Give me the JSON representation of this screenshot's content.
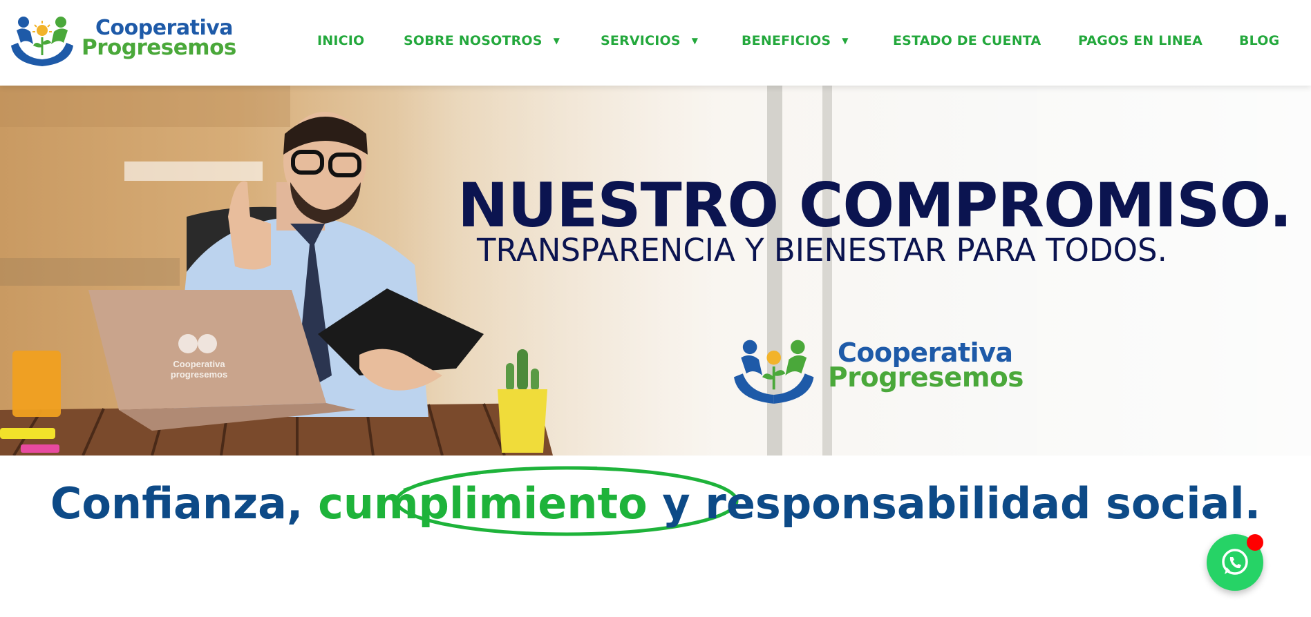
{
  "logo": {
    "line1": "Cooperativa",
    "line2": "Progresemos"
  },
  "nav": [
    {
      "label": "INICIO",
      "dropdown": false
    },
    {
      "label": "SOBRE NOSOTROS",
      "dropdown": true
    },
    {
      "label": "SERVICIOS",
      "dropdown": true
    },
    {
      "label": "BENEFICIOS",
      "dropdown": true
    },
    {
      "label": "ESTADO DE CUENTA",
      "dropdown": false
    },
    {
      "label": "PAGOS EN LINEA",
      "dropdown": false
    },
    {
      "label": "BLOG",
      "dropdown": false
    }
  ],
  "hero": {
    "title": "NUESTRO COMPROMISO.",
    "subtitle": "TRANSPARENCIA Y BIENESTAR PARA TODOS.",
    "laptop_logo": {
      "line1": "Cooperativa",
      "line2": "progresemos"
    }
  },
  "tagline": {
    "before": "Confianza, ",
    "highlight": "cumplimiento",
    "after": " y responsabilidad social."
  },
  "colors": {
    "brand_blue": "#1e5aa8",
    "brand_green": "#4aa83a",
    "nav_green": "#23a83c",
    "hero_navy": "#0b1450",
    "tagline_blue": "#0d4a87",
    "highlight_green": "#1eb33a",
    "whatsapp_green": "#26d366",
    "notification_red": "#ff0000"
  },
  "icons": {
    "logo": "cooperative-hands-logo-icon",
    "nav_caret": "caret-down-icon",
    "chat": "whatsapp-icon"
  }
}
